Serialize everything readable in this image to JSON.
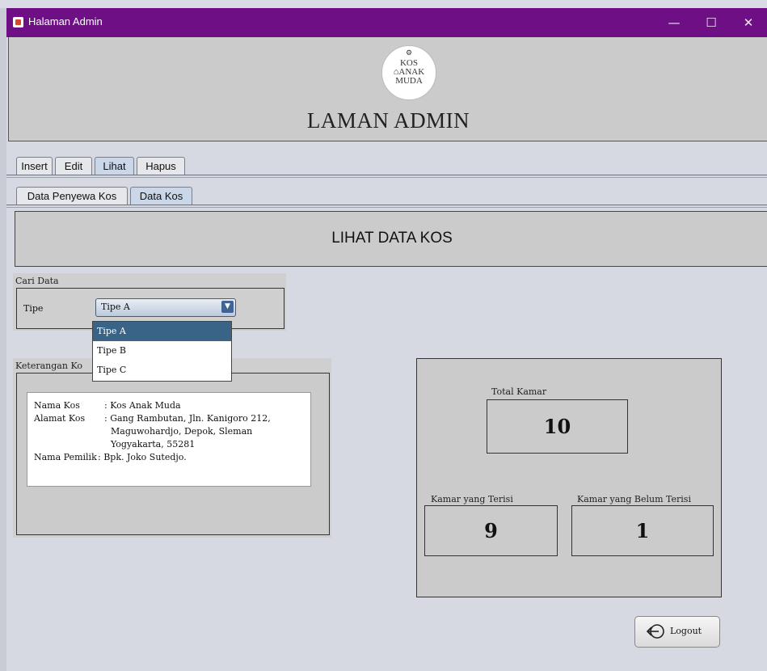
{
  "window": {
    "title": "Halaman Admin",
    "min_glyph": "—",
    "max_glyph": "☐",
    "close_glyph": "✕"
  },
  "header": {
    "logo_lines": [
      "KOS",
      "ANAK",
      "MUDA"
    ],
    "title": "LAMAN ADMIN"
  },
  "main_tabs": [
    {
      "label": "Insert",
      "active": false
    },
    {
      "label": "Edit",
      "active": false
    },
    {
      "label": "Lihat",
      "active": true
    },
    {
      "label": "Hapus",
      "active": false
    }
  ],
  "sub_tabs": [
    {
      "label": "Data Penyewa Kos",
      "active": false
    },
    {
      "label": "Data Kos",
      "active": true
    }
  ],
  "section_title": "LIHAT DATA KOS",
  "filter": {
    "group_label": "Cari Data",
    "type_label": "Tipe",
    "selected": "Tipe A",
    "options": [
      "Tipe A",
      "Tipe B",
      "Tipe C"
    ]
  },
  "info": {
    "group_label": "Keterangan Ko",
    "rows": [
      {
        "key": "Nama Kos",
        "value": ": Kos Anak Muda"
      },
      {
        "key": "Alamat Kos",
        "value": ": Gang Rambutan, Jln. Kanigoro 212,"
      },
      {
        "key": "",
        "value": "Maguwohardjo, Depok, Sleman"
      },
      {
        "key": "",
        "value": "Yogyakarta, 55281"
      },
      {
        "key": "Nama Pemilik",
        "value": ": Bpk. Joko Sutedjo."
      }
    ]
  },
  "stats": {
    "total_label": "Total Kamar",
    "total_value": "10",
    "occupied_label": "Kamar yang Terisi",
    "occupied_value": "9",
    "vacant_label": "Kamar yang Belum Terisi",
    "vacant_value": "1"
  },
  "logout_label": "Logout",
  "colors": {
    "titlebar": "#6f0f86",
    "selected_item": "#396488"
  }
}
